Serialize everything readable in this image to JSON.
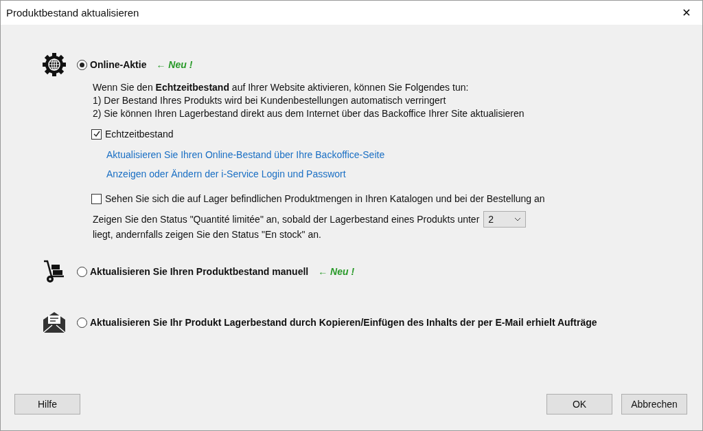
{
  "window": {
    "title": "Produktbestand aktualisieren",
    "close": "✕"
  },
  "options": [
    {
      "kind": "online",
      "label": "Online-Aktie",
      "badge": "← Neu !",
      "selected": true,
      "description": [
        "Wenn Sie den **Echtzeitbestand** auf Ihrer Website aktivieren, können Sie Folgendes tun:",
        "1) Der Bestand Ihres Produkts wird bei Kundenbestellungen automatisch verringert",
        "2) Sie können Ihren Lagerbestand direkt aus dem Internet über das Backoffice Ihrer Site aktualisieren"
      ],
      "realtime_checkbox": {
        "label": "Echtzeitbestand",
        "checked": true
      },
      "links": [
        "Aktualisieren Sie Ihren Online-Bestand über Ihre Backoffice-Seite",
        "Anzeigen oder Ändern der i-Service Login und Passwort"
      ],
      "stock_checkbox": {
        "label": "Sehen Sie sich die auf Lager befindlichen Produktmengen in Ihren Katalogen und bei der Bestellung an",
        "checked": false
      },
      "status_text_before": "Zeigen Sie den Status \"Quantité limitée\" an, sobald der Lagerbestand eines Produkts unter",
      "threshold": "2",
      "status_text_after": "liegt, andernfalls zeigen Sie den Status \"En stock\" an."
    },
    {
      "kind": "manual",
      "label": "Aktualisieren Sie Ihren Produktbestand manuell",
      "badge": "← Neu !",
      "selected": false
    },
    {
      "kind": "email",
      "label": "Aktualisieren Sie Ihr Produkt Lagerbestand durch Kopieren/Einfügen des Inhalts der per E-Mail erhielt Aufträge",
      "selected": false
    }
  ],
  "buttons": {
    "help": "Hilfe",
    "ok": "OK",
    "cancel": "Abbrechen"
  }
}
